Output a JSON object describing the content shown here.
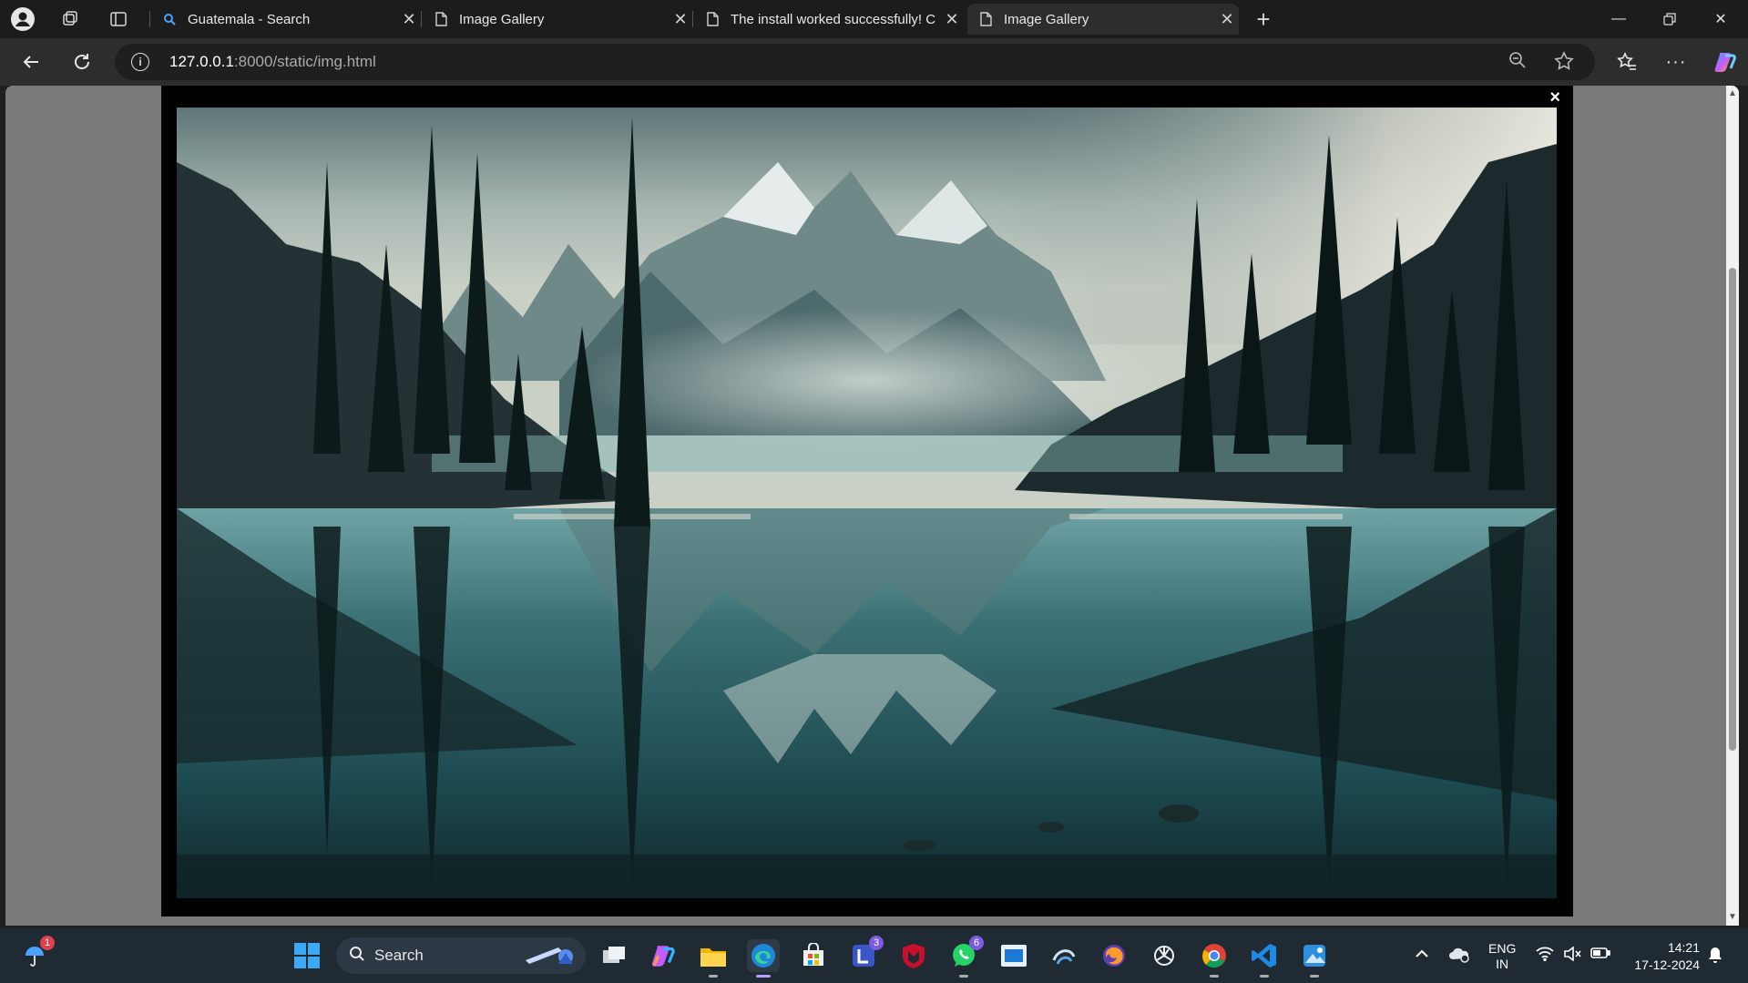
{
  "tabs": [
    {
      "title": "Guatemala - Search",
      "favicon": "search-icon",
      "active": false
    },
    {
      "title": "Image Gallery",
      "favicon": "page-icon",
      "active": false
    },
    {
      "title": "The install worked successfully! C",
      "favicon": "page-icon",
      "active": false
    },
    {
      "title": "Image Gallery",
      "favicon": "page-icon",
      "active": true
    }
  ],
  "address_bar": {
    "host": "127.0.0.1",
    "path": ":8000/static/img.html"
  },
  "lightbox": {
    "close_label": "×",
    "image_alt": "Mountain lake reflection"
  },
  "taskbar": {
    "search_label": "Search",
    "weather_badge": "1",
    "teams_badge": "3",
    "whatsapp_badge": "6"
  },
  "tray": {
    "language": "ENG",
    "region": "IN",
    "time": "14:21",
    "date": "17-12-2024"
  }
}
